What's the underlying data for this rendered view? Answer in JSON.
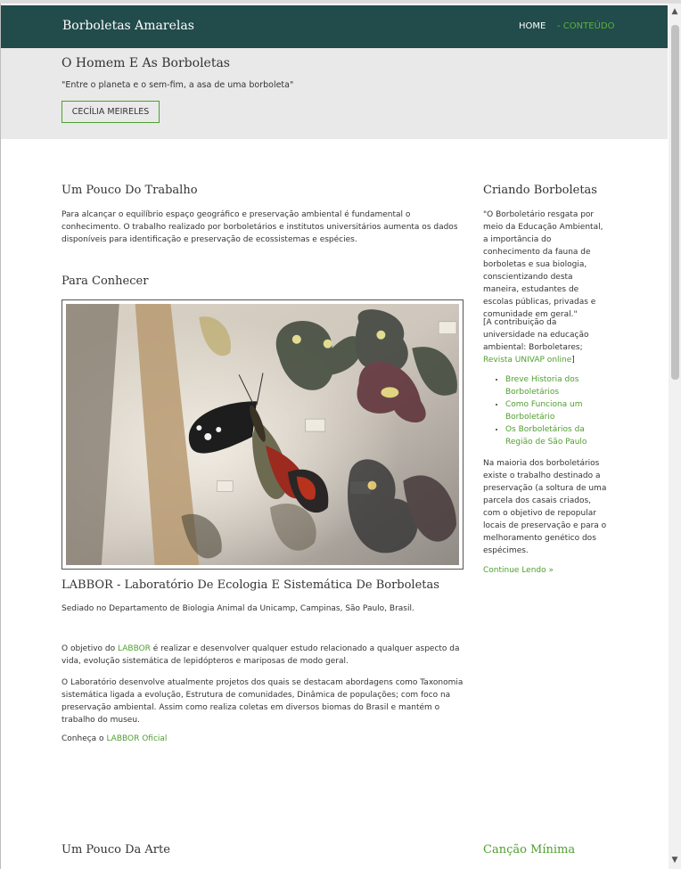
{
  "header": {
    "brand": "Borboletas Amarelas",
    "nav": [
      {
        "label": "HOME"
      },
      {
        "label": "- CONTEÚDO"
      }
    ]
  },
  "hero": {
    "title": "O Homem E As Borboletas",
    "quote": "\"Entre o planeta e o sem-fim, a asa de uma borboleta\"",
    "button_label": "CECÍLIA MEIRELES"
  },
  "main": {
    "section1": {
      "title": "Um Pouco Do Trabalho",
      "text": "Para alcançar o equilíbrio espaço geográfico e preservação ambiental é fundamental o conhecimento. O trabalho realizado por borboletários e institutos universitários aumenta os dados disponíveis para identificação e preservação de ecossistemas e espécies."
    },
    "section2": {
      "title": "Para Conhecer",
      "caption_title": "LABBOR - Laboratório De Ecologia E Sistemática De Borboletas",
      "location": "Sediado no Departamento de Biologia Animal da Unicamp, Campinas, São Paulo, Brasil.",
      "objective_before": "O objetivo do ",
      "objective_link": "LABBOR",
      "objective_after": " é realizar e desenvolver qualquer estudo relacionado a qualquer aspecto da vida, evolução sistemática de lepidópteros e mariposas de modo geral.",
      "projects": "O Laboratório desenvolve atualmente projetos dos quais se destacam abordagens como Taxonomia sistemática ligada a evolução, Estrutura de comunidades, Dinâmica de populações; com foco na preservação ambiental. Assim como realiza coletas em diversos biomas do Brasil e mantém o trabalho do museu.",
      "know_before": "Conheça o ",
      "know_link": "LABBOR Oficial"
    },
    "section3": {
      "title": "Um Pouco Da Arte"
    }
  },
  "sidebar": {
    "title": "Criando Borboletas",
    "quote": "\"O Borboletário resgata por meio da Educação Ambiental, a importância do conhecimento da fauna de borboletas e sua biologia, conscientizando desta maneira, estudantes de escolas públicas, privadas e comunidade em geral.\"",
    "source_before": "[A contribuição da universidade na educação ambiental: Borboletares; ",
    "source_link": "Revista UNIVAP online",
    "source_after": "]",
    "links": [
      {
        "label": "Breve Historia dos Borboletários"
      },
      {
        "label": "Como Funciona um Borboletário"
      },
      {
        "label": "Os Borboletários da Região de São Paulo"
      }
    ],
    "paragraph": "Na maioria dos borboletários existe o trabalho destinado a preservação (a soltura de uma parcela dos casais criados, com o objetivo de repopular locais de preservação e para o melhoramento genético dos espécimes.",
    "continue_label": "Continue Lendo »",
    "poem_title": "Canção Mínima"
  },
  "colors": {
    "navbar": "#224b4b",
    "hero_bg": "#e9e9e9",
    "accent_green": "#4f9f2f"
  },
  "icons": {
    "scroll_up": "arrow-up-icon",
    "scroll_down": "arrow-down-icon"
  }
}
